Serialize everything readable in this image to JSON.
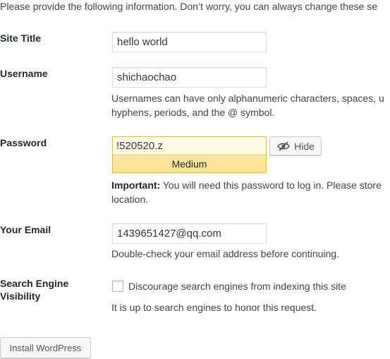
{
  "intro_text": "Please provide the following information. Don’t worry, you can always change these se",
  "site_title": {
    "label": "Site Title",
    "value": "hello world"
  },
  "username": {
    "label": "Username",
    "value": "shichaochao",
    "help_line1": "Usernames can have only alphanumeric characters, spaces, u",
    "help_line2": "hyphens, periods, and the @ symbol."
  },
  "password": {
    "label": "Password",
    "value": "!520520.z",
    "strength": "Medium",
    "hide_button": "Hide",
    "hide_icon": "eye-slash-icon",
    "important_label": "Important:",
    "important_text": " You will need this password to log in. Please store",
    "important_line2": "location."
  },
  "email": {
    "label": "Your Email",
    "value": "1439651427@qq.com",
    "help": "Double-check your email address before continuing."
  },
  "search_engine": {
    "label_line1": "Search Engine",
    "label_line2": "Visibility",
    "checkbox_label": "Discourage search engines from indexing this site",
    "checked": false,
    "help": "It is up to search engines to honor this request."
  },
  "install_button": "Install WordPress",
  "colors": {
    "strength_medium_bg": "#ffe399",
    "strength_border": "#e5c316",
    "text": "#444444"
  }
}
